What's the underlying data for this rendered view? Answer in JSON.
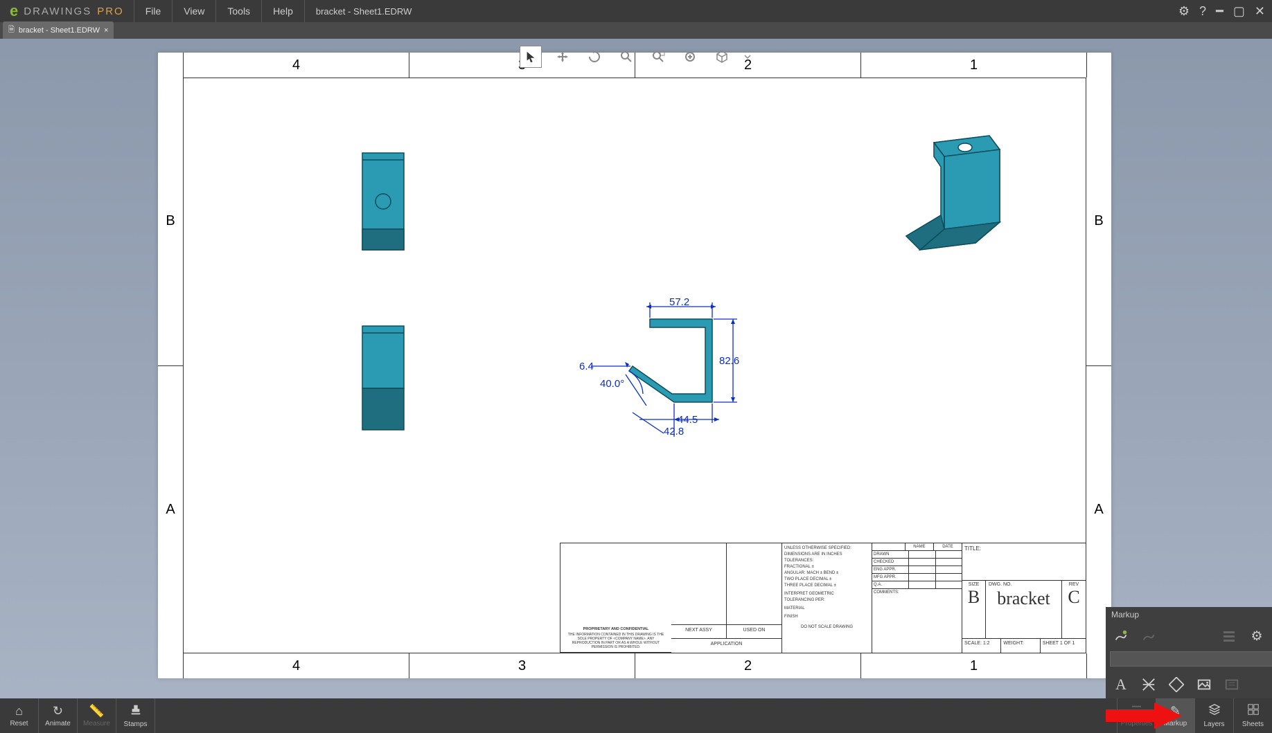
{
  "app": {
    "logo_text": "DRAWINGS",
    "logo_suffix": "PRO",
    "document": "bracket - Sheet1.EDRW"
  },
  "menu": {
    "file": "File",
    "view": "View",
    "tools": "Tools",
    "help": "Help"
  },
  "tab": {
    "label": "bracket - Sheet1.EDRW",
    "close": "×"
  },
  "ruler": {
    "cols": [
      "4",
      "3",
      "2",
      "1"
    ],
    "rows": [
      "B",
      "A"
    ]
  },
  "dimensions": {
    "d1": "57.2",
    "d2": "82.6",
    "d3": "6.4",
    "d4": "40.0°",
    "d5": "44.5",
    "d6": "42.8"
  },
  "titleblock": {
    "title_label": "TITLE:",
    "size_label": "SIZE",
    "size": "B",
    "dwg_label": "DWG. NO.",
    "dwg": "bracket",
    "rev_label": "REV",
    "rev": "C",
    "scale": "SCALE: 1:2",
    "weight": "WEIGHT:",
    "sheet": "SHEET 1 OF 1",
    "notes1": "UNLESS OTHERWISE SPECIFIED:",
    "notes2": "DIMENSIONS ARE IN INCHES",
    "notes3": "TOLERANCES:",
    "notes4": "FRACTIONAL ±",
    "notes5": "ANGULAR: MACH ±  BEND ±",
    "notes6": "TWO PLACE DECIMAL  ±",
    "notes7": "THREE PLACE DECIMAL  ±",
    "notes8": "INTERPRET GEOMETRIC",
    "notes9": "TOLERANCING PER:",
    "notes10": "MATERIAL",
    "notes11": "FINISH",
    "col_name": "NAME",
    "col_date": "DATE",
    "row_drawn": "DRAWN",
    "row_checked": "CHECKED",
    "row_engappr": "ENG APPR.",
    "row_mfgappr": "MFG APPR.",
    "row_qa": "Q.A.",
    "row_comments": "COMMENTS:",
    "prop_title": "PROPRIETARY AND CONFIDENTIAL",
    "application": "APPLICATION",
    "next_assy": "NEXT ASSY",
    "used_on": "USED ON",
    "donotscale": "DO NOT SCALE DRAWING"
  },
  "markup": {
    "title": "Markup"
  },
  "bottom": {
    "reset": "Reset",
    "animate": "Animate",
    "measure": "Measure",
    "stamps": "Stamps",
    "properties": "Properties",
    "markup": "Markup",
    "layers": "Layers",
    "sheets": "Sheets"
  }
}
